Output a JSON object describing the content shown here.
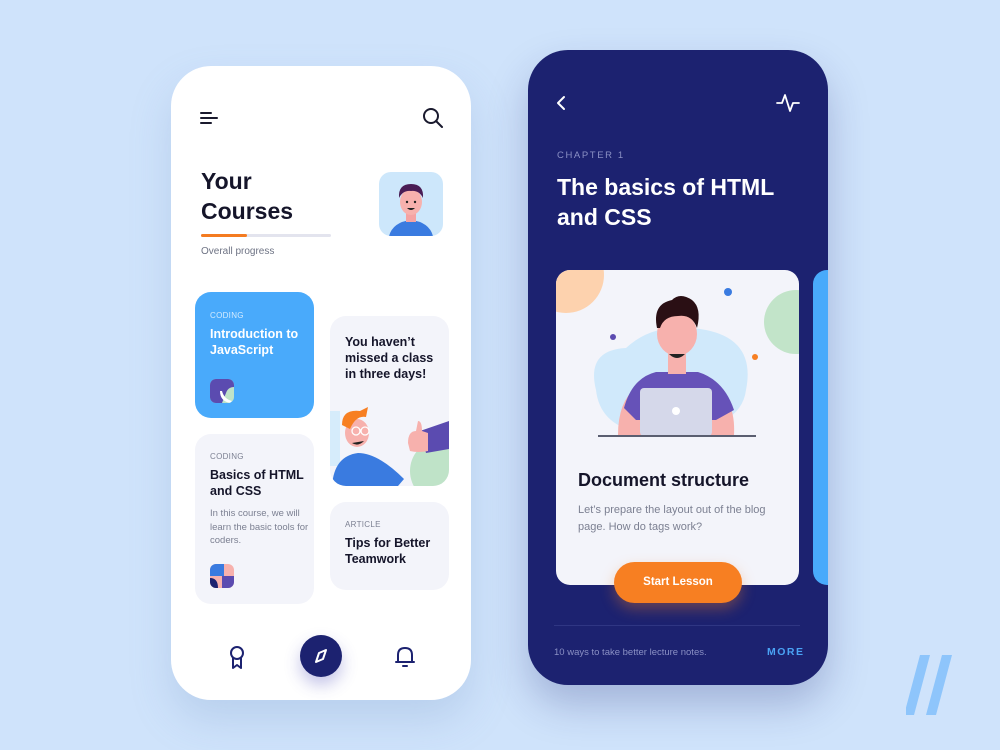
{
  "left_screen": {
    "header": {
      "menu_icon": "menu-icon",
      "search_icon": "search-icon"
    },
    "title": "Your Courses",
    "progress": {
      "label": "Overall progress",
      "value_percent": 35
    },
    "cards": [
      {
        "id": "js",
        "tag": "CODING",
        "title": "Introduction to JavaScript",
        "color": "#49aafb"
      },
      {
        "id": "motivation",
        "title": "You haven’t missed a class in three days!"
      },
      {
        "id": "html",
        "tag": "CODING",
        "title": "Basics of HTML and CSS",
        "description": "In this course, we will learn the basic tools for coders."
      },
      {
        "id": "article",
        "tag": "ARTICLE",
        "title": "Tips for Better Teamwork"
      }
    ],
    "bottom_nav": [
      {
        "icon": "award-icon"
      },
      {
        "icon": "compass-icon",
        "active": true
      },
      {
        "icon": "bell-icon"
      }
    ]
  },
  "right_screen": {
    "header": {
      "back_icon": "chevron-left-icon",
      "activity_icon": "activity-icon"
    },
    "chapter_label": "CHAPTER 1",
    "chapter_title": "The basics of HTML and CSS",
    "lesson": {
      "title": "Document structure",
      "description": "Let’s prepare the layout out of the blog page. How do tags work?",
      "button_label": "Start Lesson"
    },
    "footer": {
      "note": "10 ways to take better lecture notes.",
      "more_label": "MORE"
    }
  },
  "colors": {
    "background": "#cfe3fb",
    "navy": "#1c2270",
    "accent_orange": "#f77f22",
    "accent_blue": "#49aafb"
  }
}
